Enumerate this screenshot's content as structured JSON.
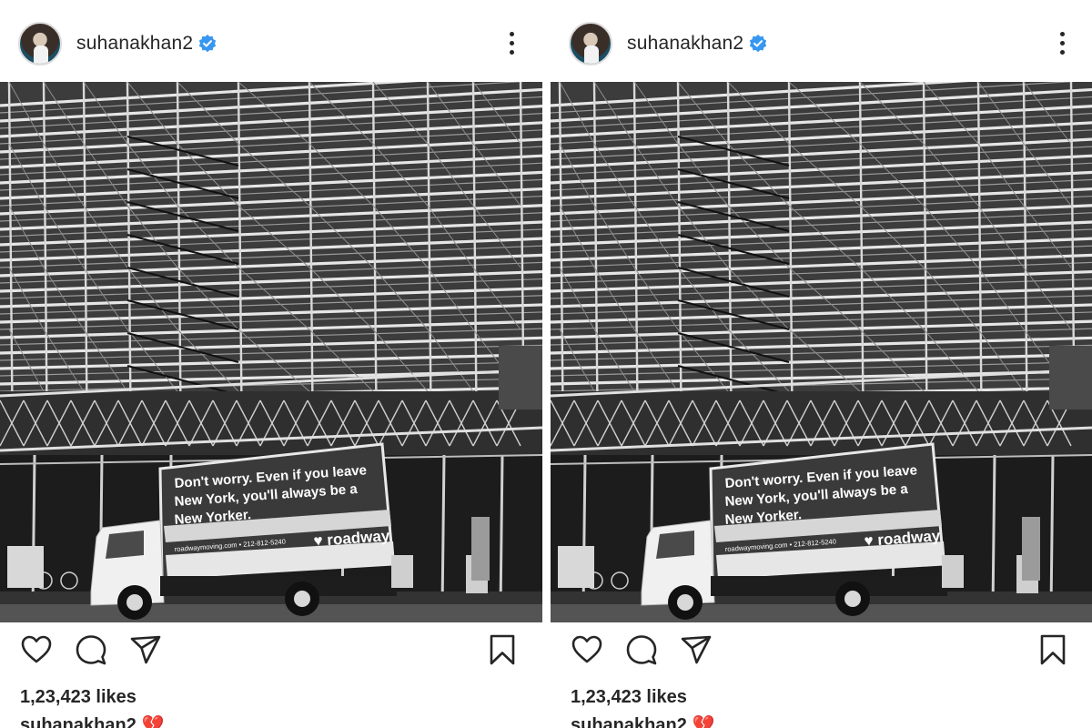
{
  "posts": [
    {
      "username": "suhanakhan2",
      "likes": "1,23,423 likes",
      "caption_user": "suhanakhan2",
      "caption_emoji": "💔",
      "truck": {
        "line1": "Don't worry. Even if you leave",
        "line2": "New York, you'll always be a",
        "line3": "New Yorker.",
        "brand": "roadway",
        "contact": "roadwaymoving.com • 212-812-5240"
      }
    },
    {
      "username": "suhanakhan2",
      "likes": "1,23,423 likes",
      "caption_user": "suhanakhan2",
      "caption_emoji": "💔",
      "truck": {
        "line1": "Don't worry. Even if you leave",
        "line2": "New York, you'll always be a",
        "line3": "New Yorker.",
        "brand": "roadway",
        "contact": "roadwaymoving.com • 212-812-5240"
      }
    }
  ],
  "colors": {
    "verified": "#3897f0",
    "text": "#262626",
    "heart_emoji": "#c4313d"
  },
  "icons": [
    "verified-badge-icon",
    "more-options-icon",
    "heart-icon",
    "comment-icon",
    "send-icon",
    "bookmark-icon"
  ]
}
